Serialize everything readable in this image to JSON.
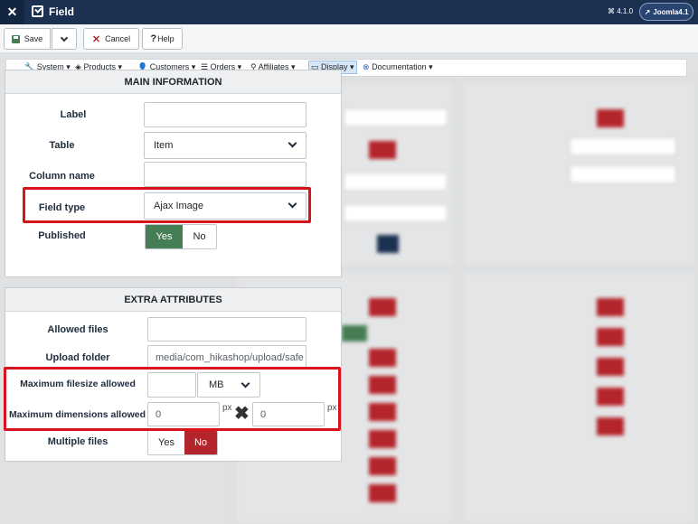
{
  "header": {
    "logo": "✕",
    "title": "Field",
    "version": "⌘ 4.1.0",
    "joomla_label": "Joomla4.1"
  },
  "toolbar": {
    "save_label": "Save",
    "cancel_label": "Cancel",
    "help_label": "Help"
  },
  "menu": {
    "items": [
      "System",
      "Products",
      "Customers",
      "Orders",
      "Affiliates",
      "Display",
      "Documentation"
    ],
    "active": "Display"
  },
  "main_info": {
    "heading": "MAIN INFORMATION",
    "label_label": "Label",
    "label_value": "",
    "table_label": "Table",
    "table_value": "Item",
    "column_label": "Column name",
    "column_value": "",
    "field_type_label": "Field type",
    "field_type_value": "Ajax Image",
    "published_label": "Published",
    "yes": "Yes",
    "no": "No",
    "published_value": "Yes"
  },
  "extra": {
    "heading": "EXTRA ATTRIBUTES",
    "allowed_files_label": "Allowed files",
    "allowed_files_value": "",
    "upload_folder_label": "Upload folder",
    "upload_folder_value": "media/com_hikashop/upload/safe",
    "max_filesize_label": "Maximum filesize allowed",
    "max_filesize_value": "",
    "max_filesize_unit": "MB",
    "max_dimensions_label": "Maximum dimensions allowed",
    "max_width": "0",
    "max_height": "0",
    "px_unit": "px",
    "times": "✖",
    "multiple_label": "Multiple files",
    "yes": "Yes",
    "no": "No",
    "multiple_value": "No"
  },
  "colors": {
    "header_bg": "#1c3152",
    "yes_active": "#457d54",
    "no_active": "#b4252b",
    "highlight": "#d8131c"
  }
}
